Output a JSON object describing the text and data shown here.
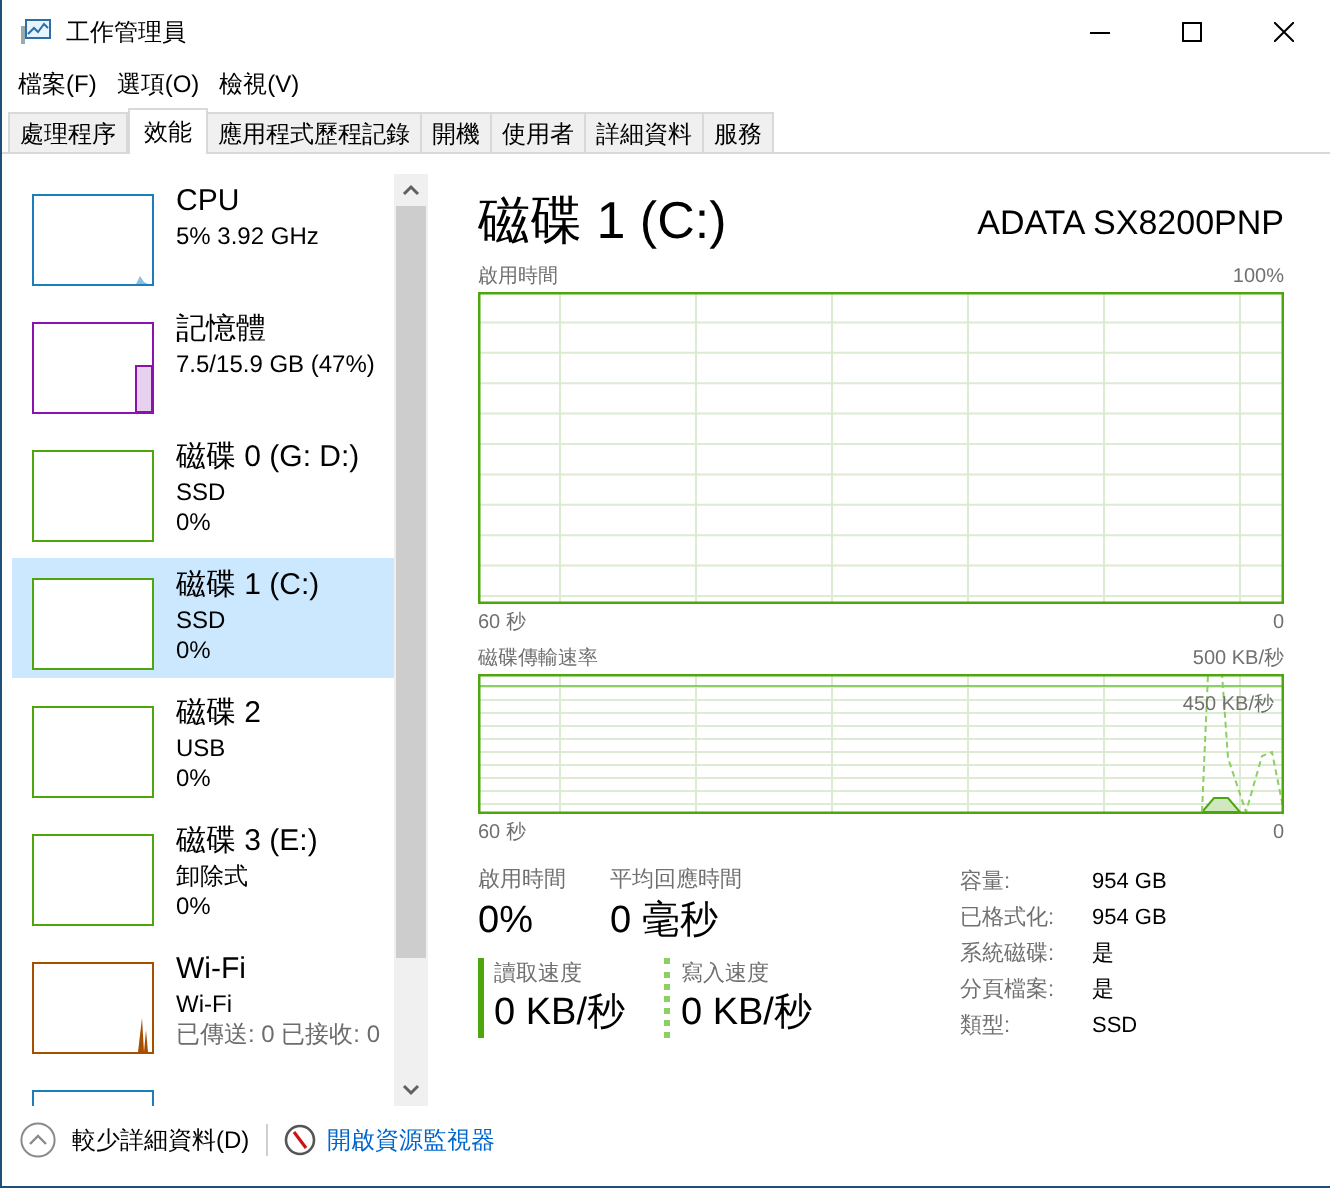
{
  "window": {
    "title": "工作管理員"
  },
  "menu": [
    "檔案(F)",
    "選項(O)",
    "檢視(V)"
  ],
  "tabs": [
    {
      "label": "處理程序",
      "selected": false
    },
    {
      "label": "效能",
      "selected": true
    },
    {
      "label": "應用程式歷程記錄",
      "selected": false
    },
    {
      "label": "開機",
      "selected": false
    },
    {
      "label": "使用者",
      "selected": false
    },
    {
      "label": "詳細資料",
      "selected": false
    },
    {
      "label": "服務",
      "selected": false
    }
  ],
  "sidebar": {
    "items": [
      {
        "kind": "cpu",
        "name": "CPU",
        "details": [
          "5%  3.92 GHz"
        ],
        "color": "#1c7dbd",
        "selected": false
      },
      {
        "kind": "memory",
        "name": "記憶體",
        "details": [
          "7.5/15.9 GB (47%)"
        ],
        "color": "#8b12ae",
        "selected": false
      },
      {
        "kind": "disk",
        "name": "磁碟 0 (G: D:)",
        "details": [
          "SSD",
          "0%"
        ],
        "color": "#4da60c",
        "selected": false
      },
      {
        "kind": "disk",
        "name": "磁碟 1 (C:)",
        "details": [
          "SSD",
          "0%"
        ],
        "color": "#4da60c",
        "selected": true
      },
      {
        "kind": "disk",
        "name": "磁碟 2",
        "details": [
          "USB",
          "0%"
        ],
        "color": "#4da60c",
        "selected": false
      },
      {
        "kind": "disk",
        "name": "磁碟 3 (E:)",
        "details": [
          "卸除式",
          "0%"
        ],
        "color": "#4da60c",
        "selected": false
      },
      {
        "kind": "network",
        "name": "Wi-Fi",
        "details": [
          "Wi-Fi",
          "已傳送: 0 已接收: 0"
        ],
        "color": "#a74f01",
        "selected": false
      },
      {
        "kind": "gpu",
        "color": "#1c7dbd",
        "selected": false
      }
    ]
  },
  "detail": {
    "title": "磁碟 1 (C:)",
    "model": "ADATA SX8200PNP",
    "charts": [
      {
        "kind": "usage",
        "label": "啟用時間",
        "max": "100%",
        "time": "60 秒",
        "min": "0"
      },
      {
        "kind": "transfer",
        "label": "磁碟傳輸速率",
        "max": "500 KB/秒",
        "inner_label": "450 KB/秒",
        "time": "60 秒",
        "min": "0"
      }
    ],
    "stats": [
      {
        "label": "啟用時間",
        "value": "0%"
      },
      {
        "label": "平均回應時間",
        "value": "0 毫秒"
      }
    ],
    "speeds": [
      {
        "kind": "solid",
        "label": "讀取速度",
        "value": "0 KB/秒"
      },
      {
        "kind": "dashed",
        "label": "寫入速度",
        "value": "0 KB/秒"
      }
    ],
    "properties": [
      {
        "label": "容量:",
        "value": "954 GB"
      },
      {
        "label": "已格式化:",
        "value": "954 GB"
      },
      {
        "label": "系統磁碟:",
        "value": "是"
      },
      {
        "label": "分頁檔案:",
        "value": "是"
      },
      {
        "label": "類型:",
        "value": "SSD"
      }
    ]
  },
  "footer": {
    "less_details": "較少詳細資料(D)",
    "resource_monitor": "開啟資源監視器"
  }
}
